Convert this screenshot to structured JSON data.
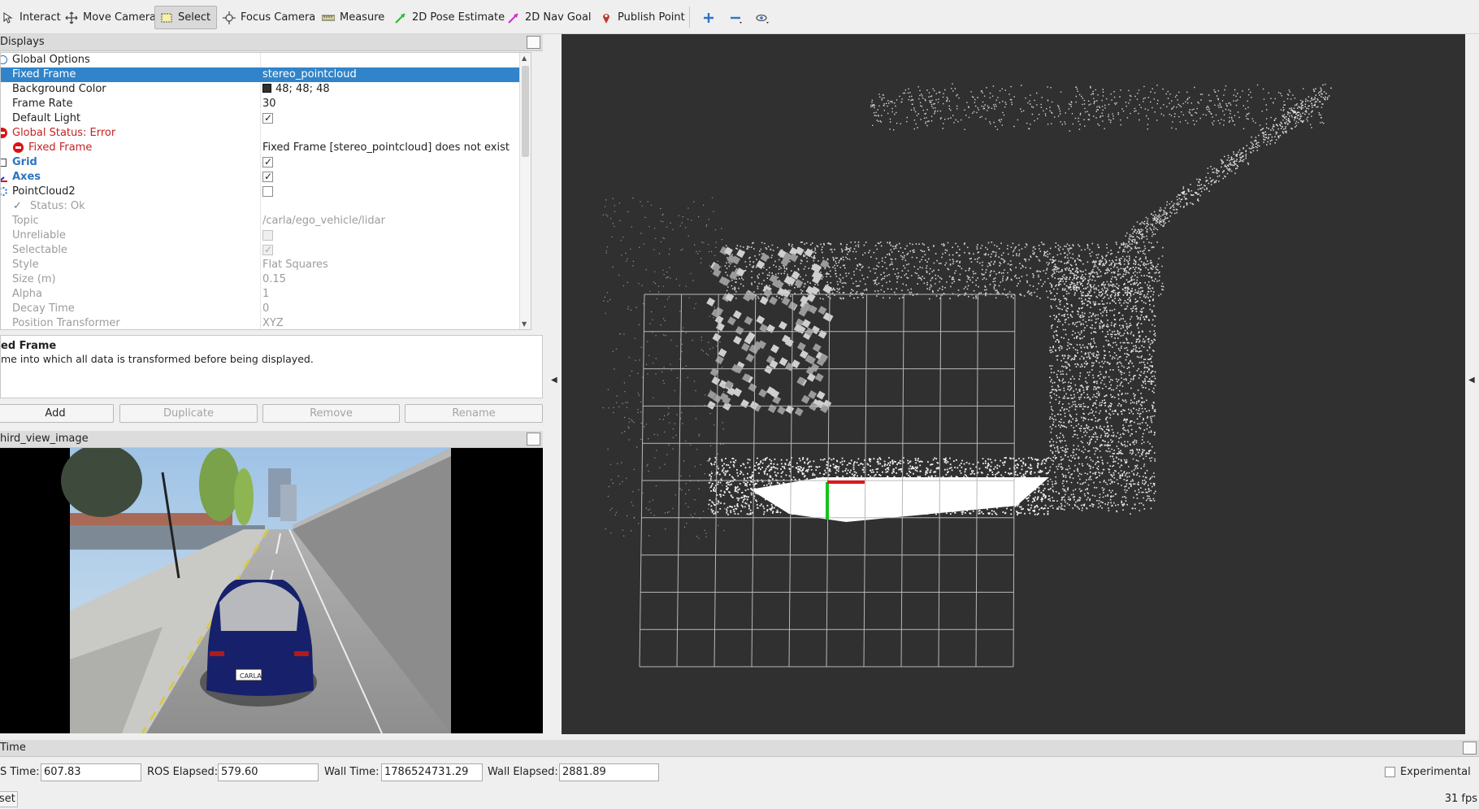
{
  "toolbar": {
    "tools": [
      {
        "label": "Interact",
        "icon": "interact-icon"
      },
      {
        "label": "Move Camera",
        "icon": "move-camera-icon"
      },
      {
        "label": "Select",
        "icon": "select-icon",
        "active": true
      },
      {
        "label": "Focus Camera",
        "icon": "focus-camera-icon"
      },
      {
        "label": "Measure",
        "icon": "measure-icon"
      },
      {
        "label": "2D Pose Estimate",
        "icon": "pose-arrow-icon"
      },
      {
        "label": "2D Nav Goal",
        "icon": "nav-arrow-icon"
      },
      {
        "label": "Publish Point",
        "icon": "map-pin-icon"
      }
    ],
    "extra_icons": [
      "plus-icon",
      "minus-icon",
      "eye-icon"
    ]
  },
  "displays": {
    "title": "Displays",
    "rows": {
      "global_options": "Global Options",
      "fixed_frame": {
        "name": "Fixed Frame",
        "value": "stereo_pointcloud"
      },
      "background_color": {
        "name": "Background Color",
        "value": "48; 48; 48"
      },
      "frame_rate": {
        "name": "Frame Rate",
        "value": "30"
      },
      "default_light": {
        "name": "Default Light",
        "checked": true
      },
      "global_status": "Global Status: Error",
      "fixed_frame_error": {
        "name": "Fixed Frame",
        "value": "Fixed Frame [stereo_pointcloud] does not exist"
      },
      "grid": {
        "name": "Grid",
        "checked": true
      },
      "axes": {
        "name": "Axes",
        "checked": true
      },
      "pointcloud2": {
        "name": "PointCloud2",
        "checked": false
      },
      "status_ok": "Status: Ok",
      "topic": {
        "name": "Topic",
        "value": "/carla/ego_vehicle/lidar"
      },
      "unreliable": {
        "name": "Unreliable",
        "checked": false
      },
      "selectable": {
        "name": "Selectable",
        "checked": true
      },
      "style": {
        "name": "Style",
        "value": "Flat Squares"
      },
      "size": {
        "name": "Size (m)",
        "value": "0.15"
      },
      "alpha": {
        "name": "Alpha",
        "value": "1"
      },
      "decay_time": {
        "name": "Decay Time",
        "value": "0"
      },
      "position_transformer": {
        "name": "Position Transformer",
        "value": "XYZ"
      }
    },
    "description": {
      "title": "ed Frame",
      "text": "me into which all data is transformed before being displayed."
    },
    "buttons": {
      "add": "Add",
      "duplicate": "Duplicate",
      "remove": "Remove",
      "rename": "Rename"
    }
  },
  "camera_panel": {
    "title": "hird_view_image",
    "plate": "CARLA"
  },
  "time_panel": {
    "title": "Time",
    "ros_time_label": "S Time:",
    "ros_time": "607.83",
    "ros_elapsed_label": "ROS Elapsed:",
    "ros_elapsed": "579.60",
    "wall_time_label": "Wall Time:",
    "wall_time": "1786524731.29",
    "wall_elapsed_label": "Wall Elapsed:",
    "wall_elapsed": "2881.89",
    "experimental": "Experimental",
    "reset": "set",
    "fps": "31 fps"
  },
  "colors": {
    "selection": "#3184c9",
    "error": "#c52222",
    "link_blue": "#2d74c2",
    "render_bg": "#303030"
  }
}
